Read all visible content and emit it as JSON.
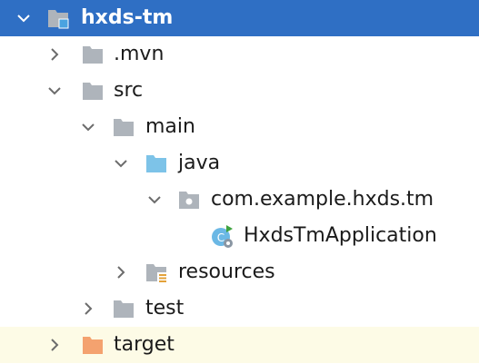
{
  "project_tree": {
    "root": {
      "label": "hxds-tm",
      "expanded": true,
      "selected": true,
      "icon": "module-folder-icon"
    },
    "items": [
      {
        "label": ".mvn",
        "expanded": false,
        "icon": "folder-icon"
      },
      {
        "label": "src",
        "expanded": true,
        "icon": "folder-icon"
      },
      {
        "label": "main",
        "expanded": true,
        "icon": "folder-icon"
      },
      {
        "label": "java",
        "expanded": true,
        "icon": "source-root-folder-icon"
      },
      {
        "label": "com.example.hxds.tm",
        "expanded": true,
        "icon": "package-icon"
      },
      {
        "label": "HxdsTmApplication",
        "icon": "spring-boot-application-class-icon"
      },
      {
        "label": "resources",
        "expanded": false,
        "icon": "resources-folder-icon"
      },
      {
        "label": "test",
        "expanded": false,
        "icon": "folder-icon"
      },
      {
        "label": "target",
        "expanded": false,
        "icon": "excluded-folder-icon"
      }
    ]
  },
  "colors": {
    "selection": "#2f6fc4",
    "excluded_row": "#fdfbe6",
    "folder_gray": "#aeb4bb",
    "source_root_blue": "#7dc3e8",
    "excluded_orange": "#f4a26f"
  }
}
